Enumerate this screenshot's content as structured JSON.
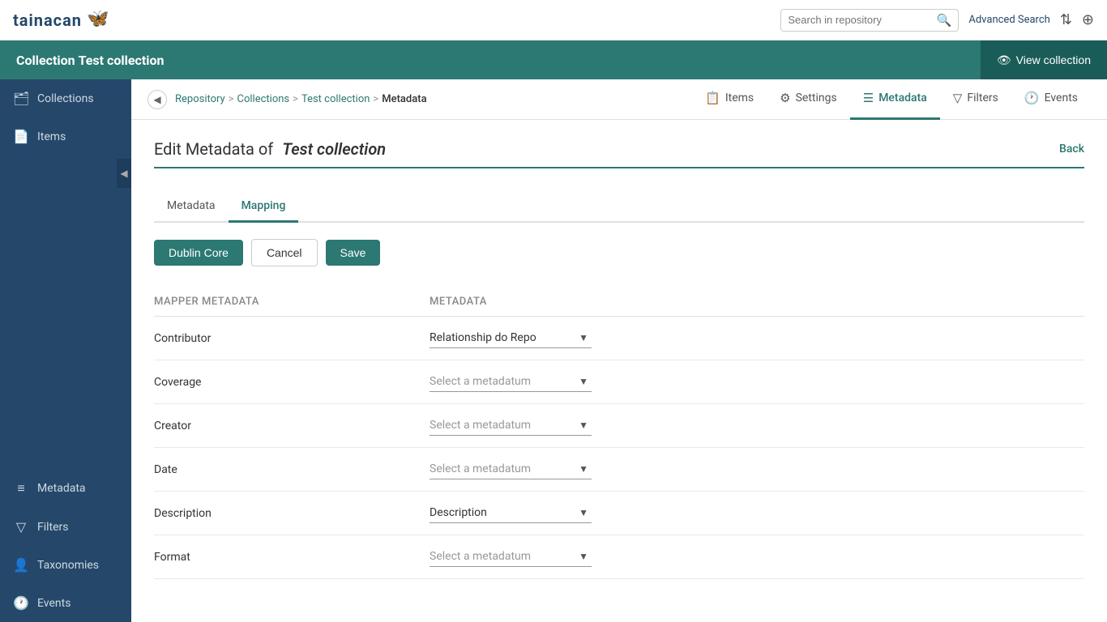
{
  "app": {
    "logo_text": "tainacan",
    "logo_butterfly": "🦋"
  },
  "top_header": {
    "search_placeholder": "Search in repository",
    "advanced_search_label": "Advanced Search"
  },
  "collection_bar": {
    "prefix": "Collection",
    "title": "Test collection",
    "view_btn": "View collection"
  },
  "sidebar": {
    "items": [
      {
        "id": "collections",
        "label": "Collections",
        "icon": "☰"
      },
      {
        "id": "items",
        "label": "Items",
        "icon": "📄"
      },
      {
        "id": "metadata",
        "label": "Metadata",
        "icon": "≡"
      },
      {
        "id": "filters",
        "label": "Filters",
        "icon": "⊽"
      },
      {
        "id": "taxonomies",
        "label": "Taxonomies",
        "icon": "👤"
      },
      {
        "id": "events",
        "label": "Events",
        "icon": "⏱"
      }
    ]
  },
  "breadcrumb": {
    "repository": "Repository",
    "collections": "Collections",
    "test_collection": "Test collection",
    "current": "Metadata"
  },
  "nav_tabs": [
    {
      "id": "items",
      "label": "Items",
      "icon": "📋",
      "active": false
    },
    {
      "id": "settings",
      "label": "Settings",
      "icon": "⚙",
      "active": false
    },
    {
      "id": "metadata",
      "label": "Metadata",
      "icon": "≡",
      "active": true
    },
    {
      "id": "filters",
      "label": "Filters",
      "icon": "⊽",
      "active": false
    },
    {
      "id": "events",
      "label": "Events",
      "icon": "⏱",
      "active": false
    }
  ],
  "page": {
    "title_prefix": "Edit Metadata of",
    "collection_name": "Test collection",
    "back_label": "Back"
  },
  "inner_tabs": [
    {
      "id": "metadata",
      "label": "Metadata",
      "active": false
    },
    {
      "id": "mapping",
      "label": "Mapping",
      "active": true
    }
  ],
  "action_buttons": {
    "dublin_core": "Dublin Core",
    "cancel": "Cancel",
    "save": "Save"
  },
  "mapping_table": {
    "col_mapper": "Mapper Metadata",
    "col_meta": "Metadata",
    "rows": [
      {
        "mapper": "Contributor",
        "meta": "Relationship do Repo",
        "is_placeholder": false
      },
      {
        "mapper": "Coverage",
        "meta": "Select a metadatum",
        "is_placeholder": true
      },
      {
        "mapper": "Creator",
        "meta": "Select a metadatum",
        "is_placeholder": true
      },
      {
        "mapper": "Date",
        "meta": "Select a metadatum",
        "is_placeholder": true
      },
      {
        "mapper": "Description",
        "meta": "Description",
        "is_placeholder": false
      },
      {
        "mapper": "Format",
        "meta": "Select a metadatum",
        "is_placeholder": true
      }
    ]
  }
}
